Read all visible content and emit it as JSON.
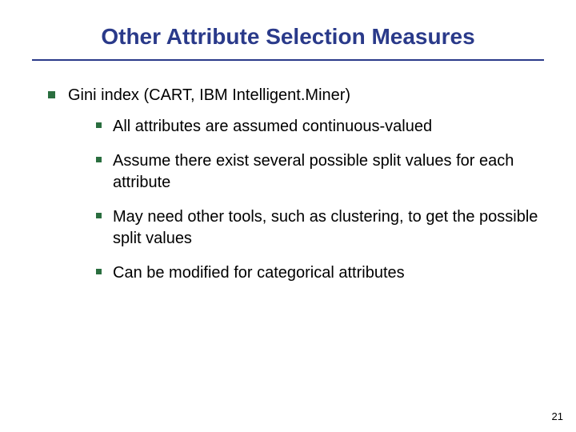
{
  "title": "Other Attribute Selection Measures",
  "main": {
    "heading": "Gini index (CART, IBM Intelligent.Miner)",
    "items": [
      "All attributes are assumed continuous-valued",
      "Assume there exist several possible split values for each attribute",
      "May need other tools, such as clustering, to get the possible split values",
      "Can be modified for categorical attributes"
    ]
  },
  "page_number": "21"
}
